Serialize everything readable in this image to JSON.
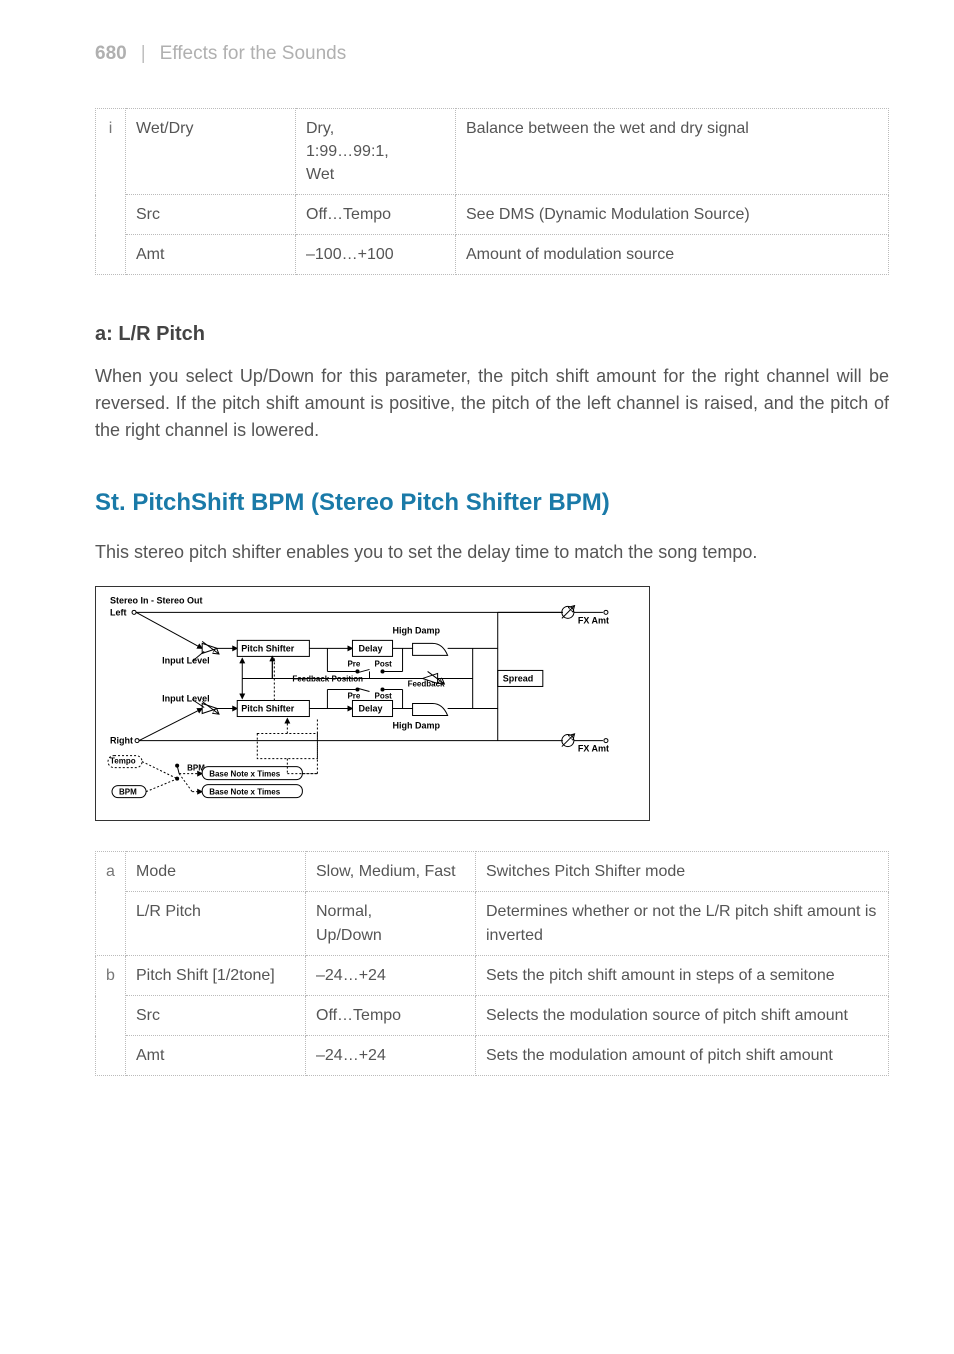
{
  "header": {
    "page_number": "680",
    "separator": "|",
    "chapter": "Effects for the Sounds"
  },
  "table1": {
    "rows": [
      {
        "idx": "i",
        "param": "Wet/Dry",
        "range": "Dry,\n1:99…99:1,\nWet",
        "desc": "Balance between the wet and dry signal"
      },
      {
        "idx": "",
        "param": "Src",
        "range": "Off…Tempo",
        "desc": "See DMS (Dynamic Modulation Source)"
      },
      {
        "idx": "",
        "param": "Amt",
        "range": "–100…+100",
        "desc": "Amount of modulation source"
      }
    ]
  },
  "section_a": {
    "heading": "a: L/R Pitch",
    "text": "When you select Up/Down for this parameter, the pitch shift amount for the right channel will be reversed. If the pitch shift amount is positive, the pitch of the left channel is raised, and the pitch of the right channel is lowered."
  },
  "section_main": {
    "title": "St. PitchShift BPM (Stereo Pitch Shifter BPM)",
    "intro": "This stereo pitch shifter enables you to set the delay time to match the song tempo."
  },
  "diagram": {
    "title": "Stereo In - Stereo Out",
    "left": "Left",
    "right": "Right",
    "input_level": "Input Level",
    "pitch_shifter": "Pitch Shifter",
    "delay": "Delay",
    "high_damp": "High Damp",
    "feedback_position": "Feedback Position",
    "feedback": "Feedback",
    "spread": "Spread",
    "pre": "Pre",
    "post": "Post",
    "fx_amt": "FX Amt",
    "tempo": "Tempo",
    "bpm": "BPM",
    "base_note": "Base Note x Times"
  },
  "table2": {
    "rows": [
      {
        "idx": "a",
        "param": "Mode",
        "range": "Slow, Medium, Fast",
        "desc": "Switches Pitch Shifter mode"
      },
      {
        "idx": "",
        "param": "L/R Pitch",
        "range": "Normal,\nUp/Down",
        "desc": "Determines whether or not the L/R pitch shift amount is inverted"
      },
      {
        "idx": "b",
        "param": "Pitch Shift [1/2tone]",
        "range": "–24…+24",
        "desc": "Sets the pitch shift amount in steps of a semitone"
      },
      {
        "idx": "",
        "param": "Src",
        "range": "Off…Tempo",
        "desc": "Selects the modulation source of pitch shift amount"
      },
      {
        "idx": "",
        "param": "Amt",
        "range": "–24…+24",
        "desc": "Sets the modulation amount of pitch shift amount"
      }
    ]
  }
}
